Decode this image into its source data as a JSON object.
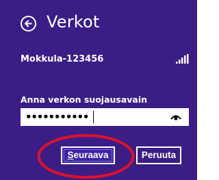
{
  "header": {
    "title": "Verkot",
    "back_icon": "arrow-left-circle-icon"
  },
  "network": {
    "name": "Mokkula-123456",
    "signal_icon": "wifi-signal-bars-icon"
  },
  "security_key": {
    "label": "Anna verkon suojausavain",
    "masked_value": "•••••••••••",
    "reveal_icon": "eye-icon"
  },
  "buttons": {
    "next_label_first": "S",
    "next_label_rest": "euraava",
    "cancel_label": "Peruuta"
  },
  "colors": {
    "background": "#3a1e86",
    "highlight_ring": "#e0102a",
    "text": "#ffffff"
  }
}
